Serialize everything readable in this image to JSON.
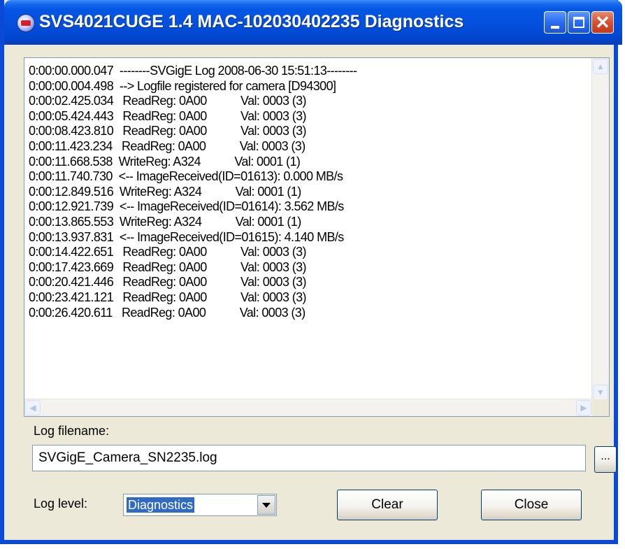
{
  "window": {
    "title": "SVS4021CUGE 1.4  MAC-102030402235 Diagnostics"
  },
  "log": {
    "lines": [
      "0:00:00.000.047  --------SVGigE Log 2008-06-30 15:51:13--------",
      "0:00:00.004.498  --> Logfile registered for camera [D94300]",
      "0:00:02.425.034   ReadReg: 0A00           Val: 0003 (3)",
      "0:00:05.424.443   ReadReg: 0A00           Val: 0003 (3)",
      "0:00:08.423.810   ReadReg: 0A00           Val: 0003 (3)",
      "0:00:11.423.234   ReadReg: 0A00           Val: 0003 (3)",
      "0:00:11.668.538  WriteReg: A324           Val: 0001 (1)",
      "0:00:11.740.730  <-- ImageReceived(ID=01613): 0.000 MB/s",
      "0:00:12.849.516  WriteReg: A324           Val: 0001 (1)",
      "0:00:12.921.739  <-- ImageReceived(ID=01614): 3.562 MB/s",
      "0:00:13.865.553  WriteReg: A324           Val: 0001 (1)",
      "0:00:13.937.831  <-- ImageReceived(ID=01615): 4.140 MB/s",
      "0:00:14.422.651   ReadReg: 0A00           Val: 0003 (3)",
      "0:00:17.423.669   ReadReg: 0A00           Val: 0003 (3)",
      "0:00:20.421.446   ReadReg: 0A00           Val: 0003 (3)",
      "0:00:23.421.121   ReadReg: 0A00           Val: 0003 (3)",
      "0:00:26.420.611   ReadReg: 0A00           Val: 0003 (3)"
    ]
  },
  "log_filename": {
    "label": "Log filename:",
    "value": "SVGigE_Camera_SN2235.log",
    "browse_label": "..."
  },
  "log_level": {
    "label": "Log level:",
    "selected": "Diagnostics"
  },
  "buttons": {
    "clear": "Clear",
    "close": "Close"
  },
  "icons": {
    "app": "camera-app-icon",
    "minimize": "minimize-icon",
    "maximize": "maximize-icon",
    "close": "close-icon",
    "dropdown": "chevron-down-icon"
  },
  "colors": {
    "titlebar": "#0350dc",
    "selection": "#316ac5",
    "close_button": "#d8502f",
    "window_bg": "#ece9d8"
  }
}
